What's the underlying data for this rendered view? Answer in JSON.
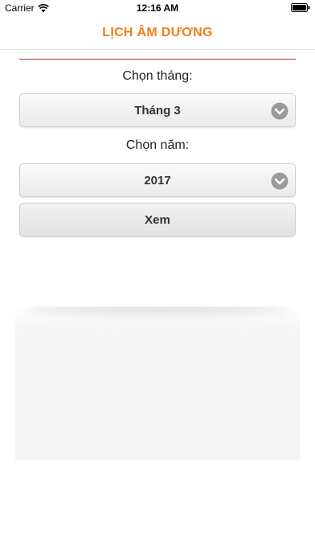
{
  "status_bar": {
    "carrier": "Carrier",
    "time": "12:16 AM",
    "wifi_icon": "wifi-icon",
    "battery_icon": "battery-icon"
  },
  "nav": {
    "title": "LỊCH ÂM DƯƠNG",
    "title_color": "#f07e1a"
  },
  "form": {
    "month_label": "Chọn tháng:",
    "month_value": "Tháng 3",
    "year_label": "Chọn năm:",
    "year_value": "2017",
    "view_button": "Xem",
    "dropdown_icon": "chevron-down-circle-icon",
    "divider_color": "#b8322a"
  }
}
